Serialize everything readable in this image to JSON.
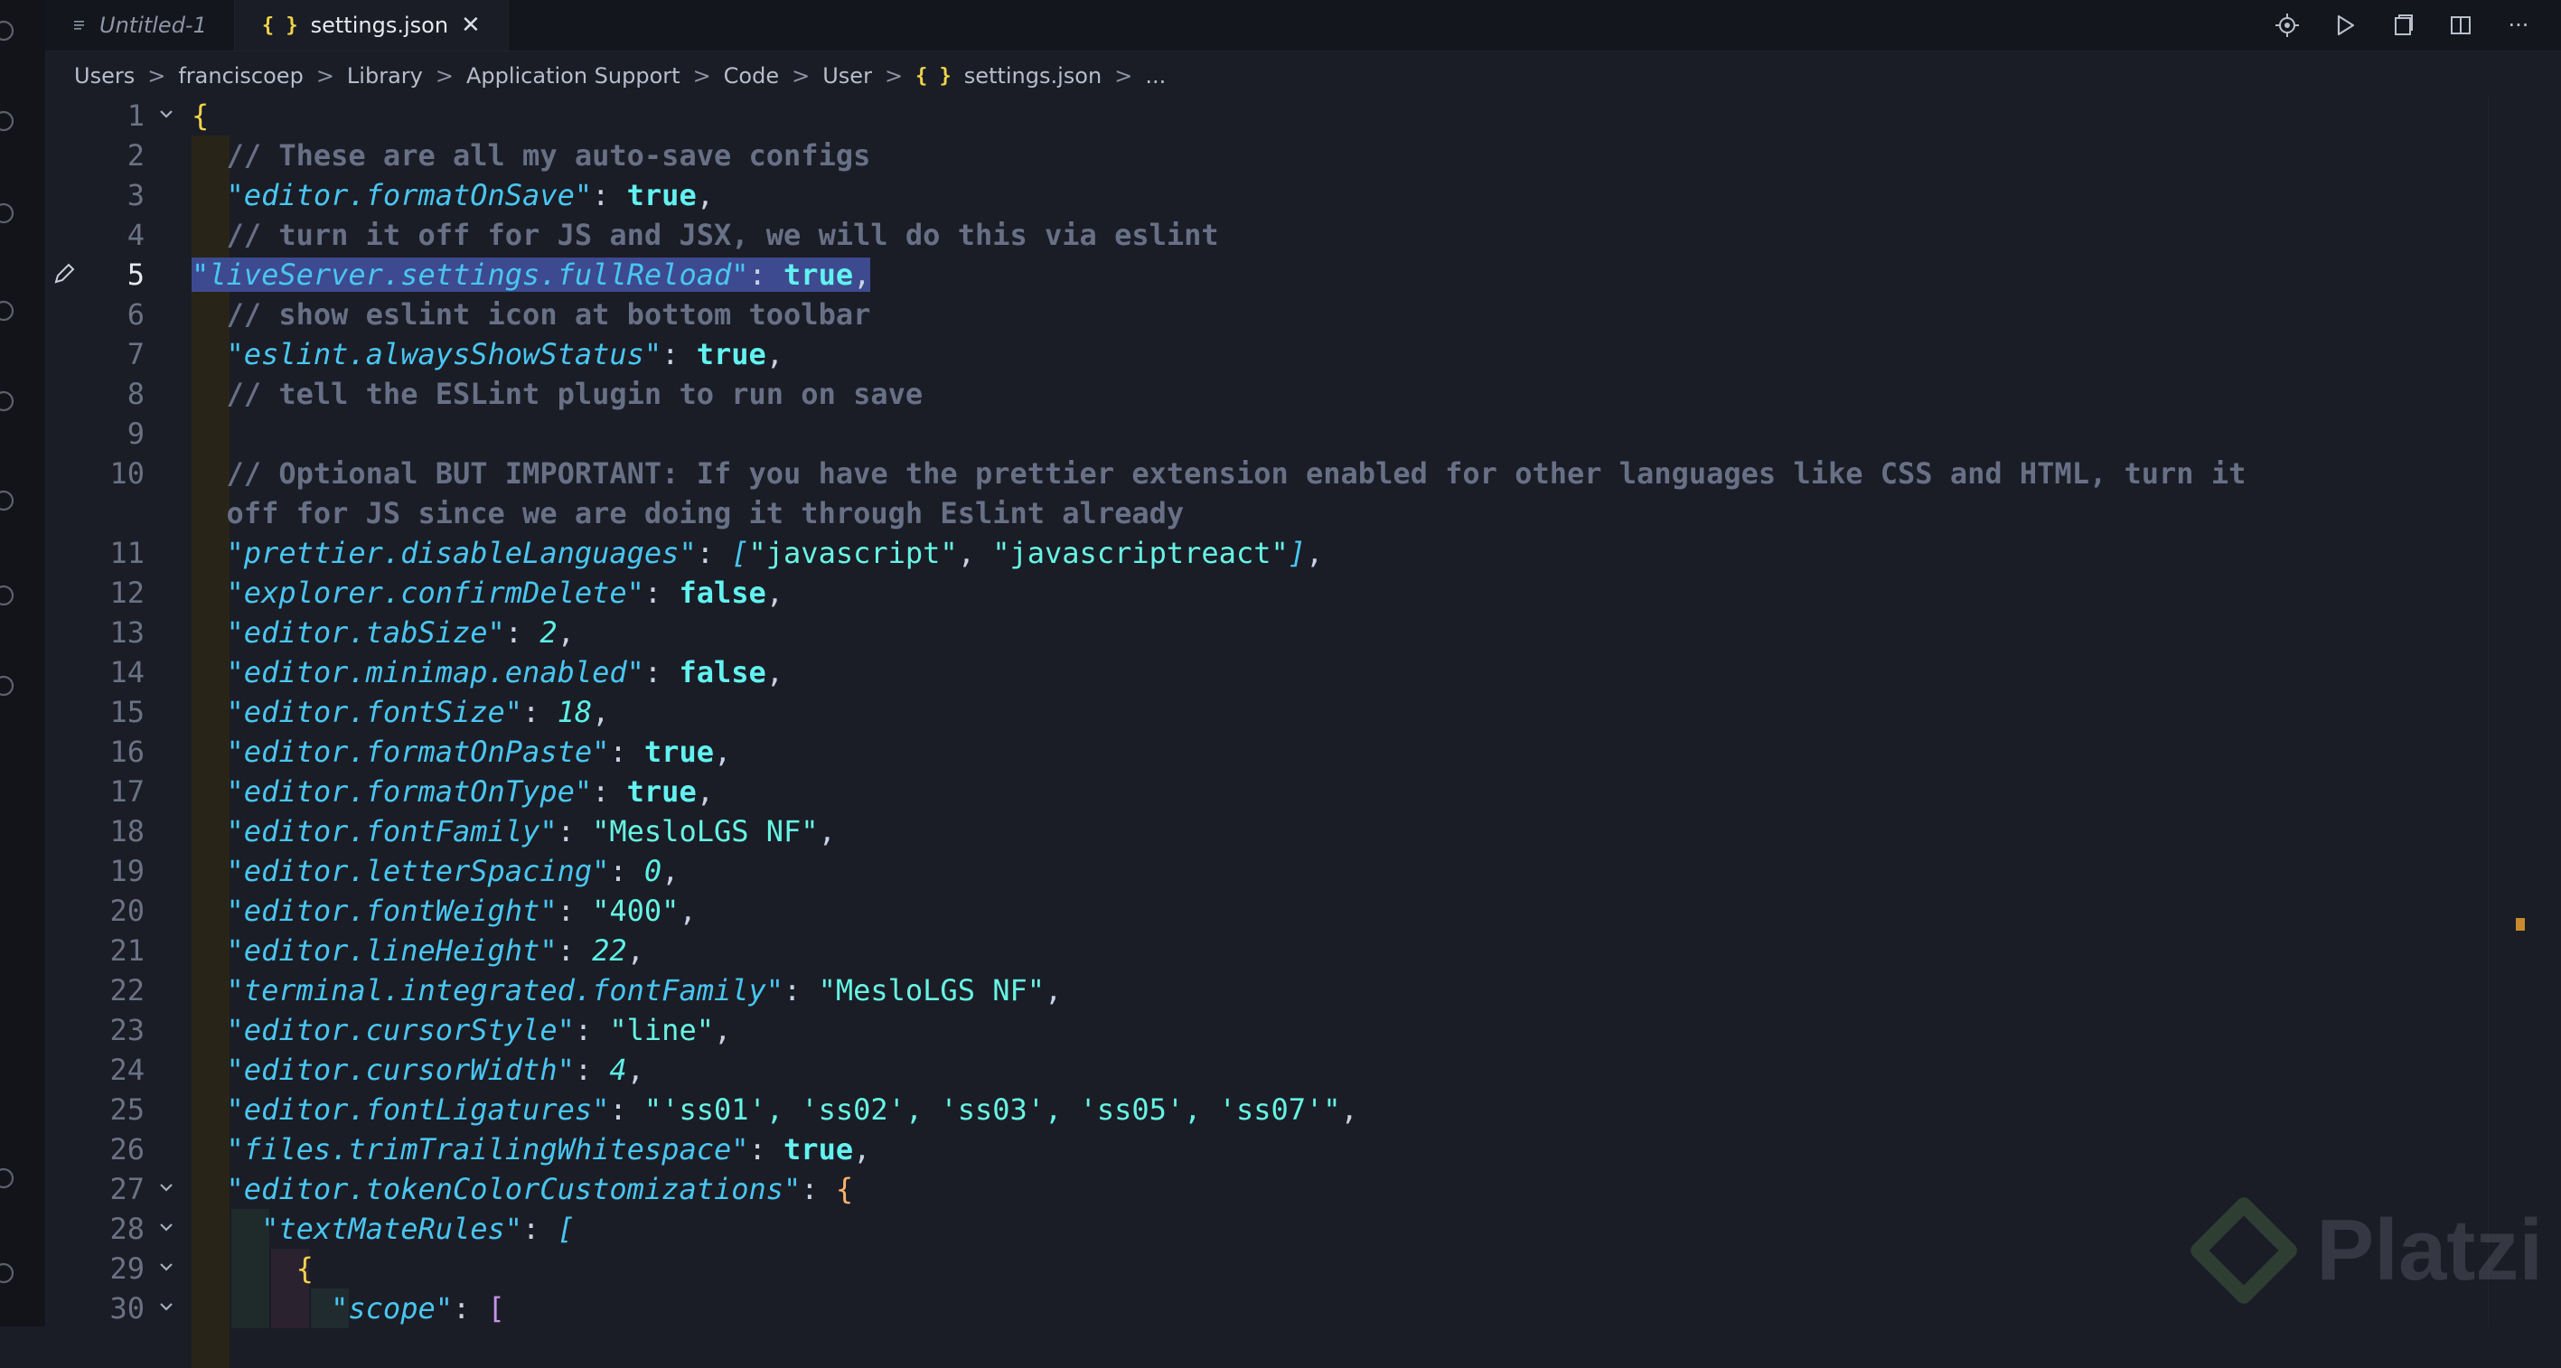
{
  "tabs": [
    {
      "label": "Untitled-1",
      "icon": "menu-lines-icon",
      "active": false
    },
    {
      "label": "settings.json",
      "icon": "json-braces-icon",
      "active": true
    }
  ],
  "tab_json_icon": "{ }",
  "close_glyph": "✕",
  "breadcrumb": [
    "Users",
    "franciscoep",
    "Library",
    "Application Support",
    "Code",
    "User",
    "settings.json",
    "..."
  ],
  "breadcrumb_sep": ">",
  "toolbar": [
    "target-icon",
    "run-icon",
    "open-changes-icon",
    "split-editor-icon",
    "more-actions-icon"
  ],
  "more_glyph": "···",
  "activity_icons": [
    "files-icon",
    "search-icon",
    "source-control-icon",
    "run-debug-icon",
    "extensions-icon",
    "remote-icon",
    "docker-icon",
    "share-icon",
    "account-icon",
    "settings-gear-icon"
  ],
  "colors": {
    "background": "#1a1d26",
    "comment": "#687086",
    "key": "#49c6f1",
    "boolean": "#62f2f0",
    "string": "#67f4e4",
    "selection": "#3d4a8f"
  },
  "watermark": "Platzi",
  "editor": {
    "current_line": 5,
    "lines": [
      {
        "n": "1",
        "text": "{"
      },
      {
        "n": "2",
        "text": "  // These are all my auto-save configs"
      },
      {
        "n": "3",
        "text": "  \"editor.formatOnSave\": true,"
      },
      {
        "n": "4",
        "text": "  // turn it off for JS and JSX, we will do this via eslint"
      },
      {
        "n": "5",
        "text": "\"liveServer.settings.fullReload\": true,"
      },
      {
        "n": "6",
        "text": "  // show eslint icon at bottom toolbar"
      },
      {
        "n": "7",
        "text": "  \"eslint.alwaysShowStatus\": true,"
      },
      {
        "n": "8",
        "text": "  // tell the ESLint plugin to run on save"
      },
      {
        "n": "9",
        "text": ""
      },
      {
        "n": "10",
        "text": "  // Optional BUT IMPORTANT: If you have the prettier extension enabled for other languages like CSS and HTML, turn it"
      },
      {
        "n": "",
        "text": "  off for JS since we are doing it through Eslint already"
      },
      {
        "n": "11",
        "text": "  \"prettier.disableLanguages\": [\"javascript\", \"javascriptreact\"],"
      },
      {
        "n": "12",
        "text": "  \"explorer.confirmDelete\": false,"
      },
      {
        "n": "13",
        "text": "  \"editor.tabSize\": 2,"
      },
      {
        "n": "14",
        "text": "  \"editor.minimap.enabled\": false,"
      },
      {
        "n": "15",
        "text": "  \"editor.fontSize\": 18,"
      },
      {
        "n": "16",
        "text": "  \"editor.formatOnPaste\": true,"
      },
      {
        "n": "17",
        "text": "  \"editor.formatOnType\": true,"
      },
      {
        "n": "18",
        "text": "  \"editor.fontFamily\": \"MesloLGS NF\","
      },
      {
        "n": "19",
        "text": "  \"editor.letterSpacing\": 0,"
      },
      {
        "n": "20",
        "text": "  \"editor.fontWeight\": \"400\","
      },
      {
        "n": "21",
        "text": "  \"editor.lineHeight\": 22,"
      },
      {
        "n": "22",
        "text": "  \"terminal.integrated.fontFamily\": \"MesloLGS NF\","
      },
      {
        "n": "23",
        "text": "  \"editor.cursorStyle\": \"line\","
      },
      {
        "n": "24",
        "text": "  \"editor.cursorWidth\": 4,"
      },
      {
        "n": "25",
        "text": "  \"editor.fontLigatures\": \"'ss01', 'ss02', 'ss03', 'ss05', 'ss07'\","
      },
      {
        "n": "26",
        "text": "  \"files.trimTrailingWhitespace\": true,"
      },
      {
        "n": "27",
        "text": "  \"editor.tokenColorCustomizations\": {"
      },
      {
        "n": "28",
        "text": "    \"textMateRules\": ["
      },
      {
        "n": "29",
        "text": "      {"
      },
      {
        "n": "30",
        "text": "        \"scope\": ["
      }
    ]
  }
}
